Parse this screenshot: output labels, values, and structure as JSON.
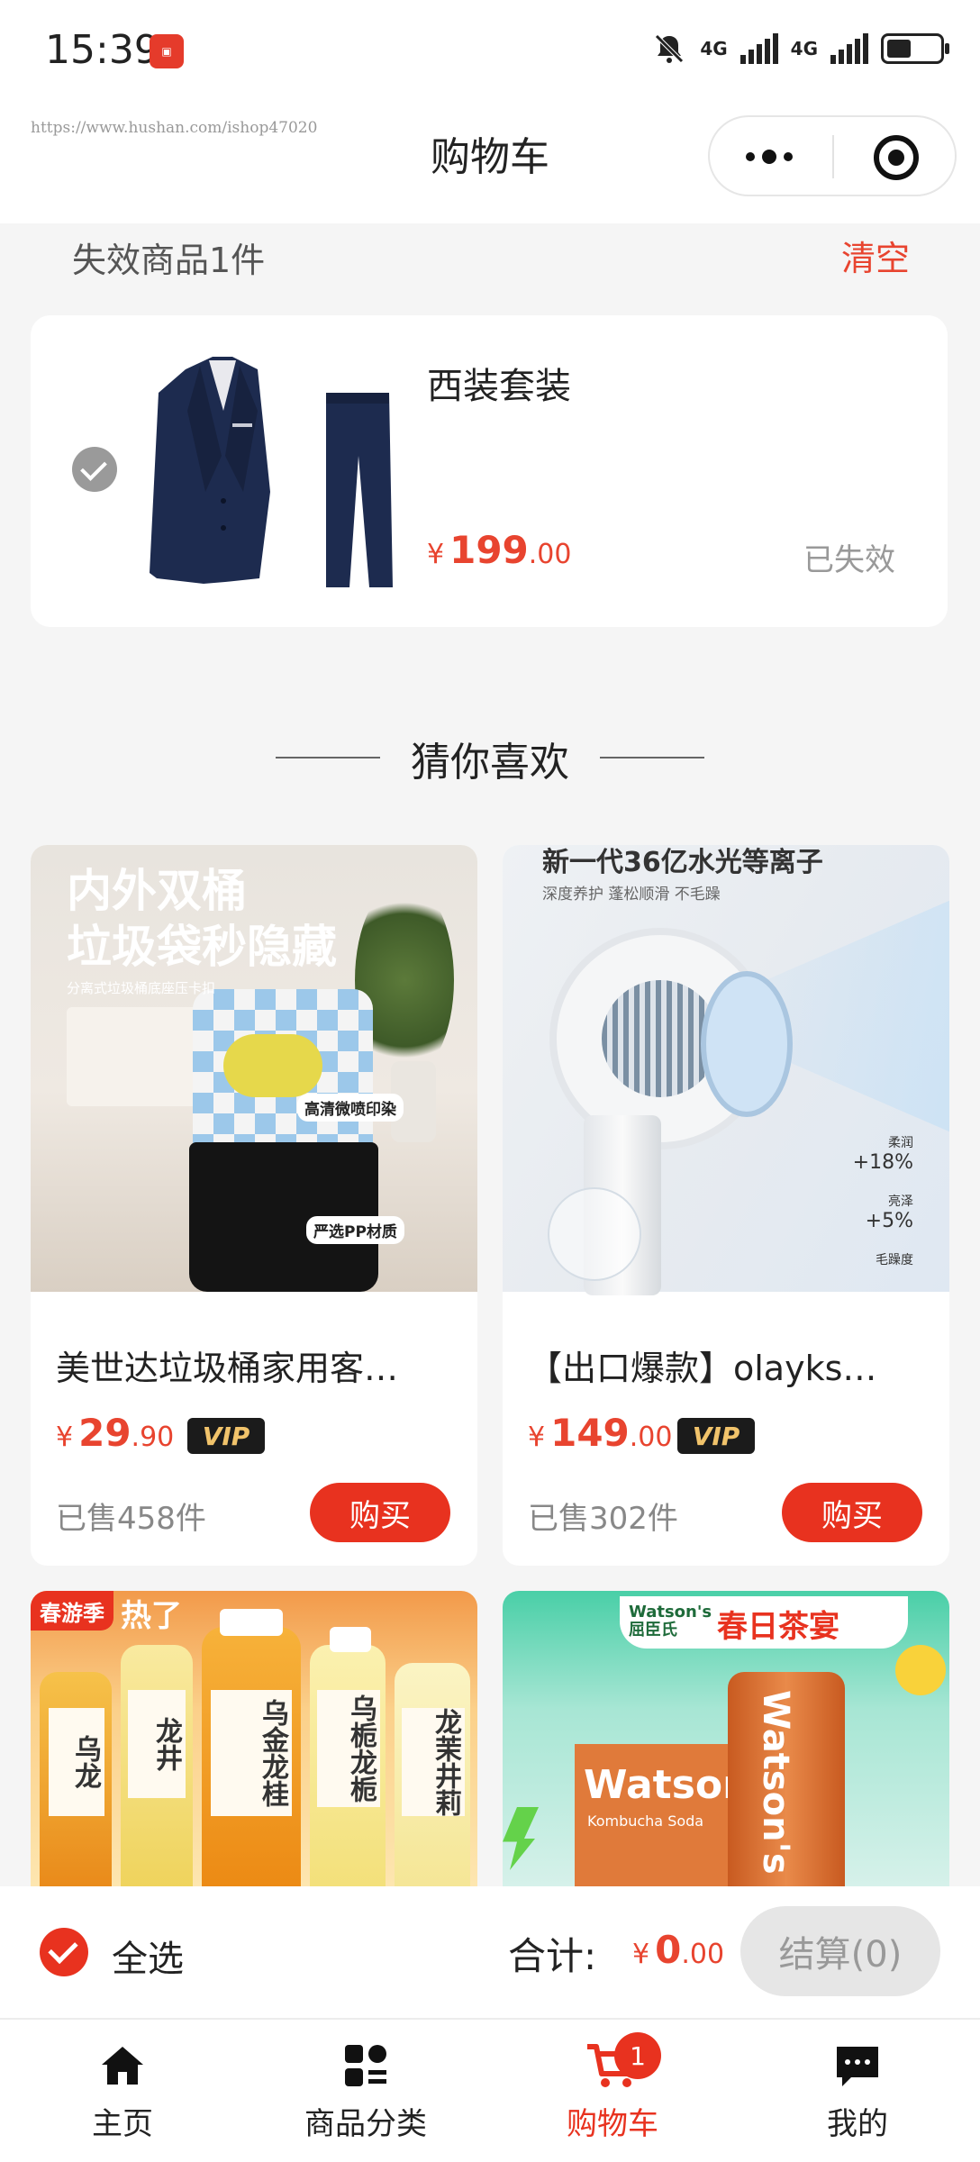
{
  "status_bar": {
    "time": "15:39",
    "net1": "4G",
    "net2": "4G"
  },
  "header": {
    "url_watermark": "https://www.hushan.com/ishop47020",
    "title": "购物车"
  },
  "invalid_section": {
    "title": "失效商品1件",
    "clear_label": "清空",
    "item": {
      "name": "西装套装",
      "price_symbol": "¥",
      "price_int": "199",
      "price_dec": ".00",
      "status": "已失效"
    }
  },
  "recommend": {
    "title": "猜你喜欢",
    "products": [
      {
        "name": "美世达垃圾桶家用客…",
        "price_symbol": "¥",
        "price_int": "29",
        "price_dec": ".90",
        "vip": "VIP",
        "sold": "已售458件",
        "buy_label": "购买",
        "img_title1": "内外双桶",
        "img_title2": "垃圾袋秒隐藏",
        "img_sub": "分离式垃圾桶底座压卡扣",
        "img_feature1": "高清微喷印染",
        "img_feature2": "严选PP材质"
      },
      {
        "name": "【出口爆款】olayks…",
        "price_symbol": "¥",
        "price_int": "149",
        "price_dec": ".00",
        "vip": "VIP",
        "sold": "已售302件",
        "buy_label": "购买",
        "img_title": "新一代36亿水光等离子",
        "img_sub": "深度养护 蓬松顺滑 不毛躁",
        "stat1_label": "柔润",
        "stat1_value": "+18%",
        "stat2_label": "亮泽",
        "stat2_value": "+5%",
        "stat3_label": "毛躁度"
      },
      {
        "img_tag": "春游季",
        "img_tag2": "热了",
        "bottle_labels": [
          "乌龙",
          "龙井",
          "乌金龙桂",
          "乌栀龙栀",
          "龙茉井莉"
        ]
      },
      {
        "img_brand": "Watson's 屈臣氏",
        "img_title": "春日茶宴",
        "box_text": "Watsor",
        "box_sub": "Kombucha Soda",
        "can_text": "Watson's"
      }
    ]
  },
  "summary": {
    "select_all_label": "全选",
    "total_label": "合计:",
    "total_symbol": "¥",
    "total_int": "0",
    "total_dec": ".00",
    "checkout_label": "结算(0)"
  },
  "tabbar": {
    "items": [
      {
        "label": "主页"
      },
      {
        "label": "商品分类"
      },
      {
        "label": "购物车"
      },
      {
        "label": "我的"
      }
    ],
    "cart_badge": "1"
  },
  "colors": {
    "accent": "#e8321f",
    "price": "#e8442f",
    "muted": "#999999"
  }
}
